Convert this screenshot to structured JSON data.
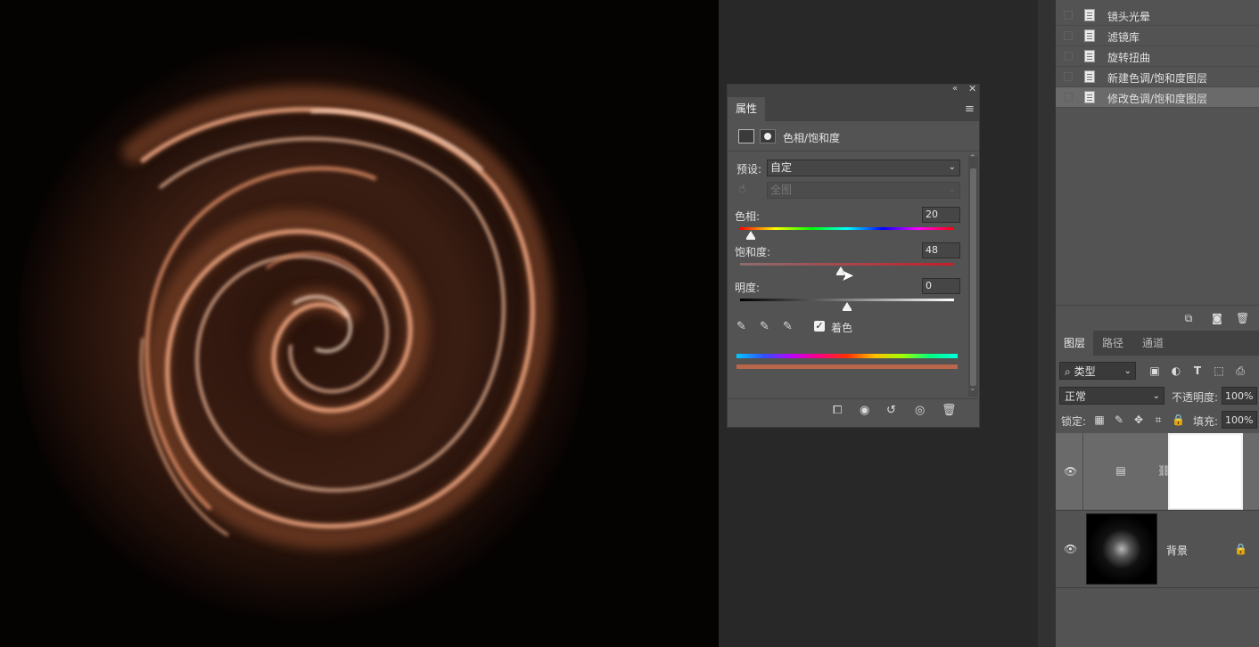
{
  "history": {
    "items": [
      {
        "label": "镜头光晕",
        "selected": false
      },
      {
        "label": "滤镜库",
        "selected": false
      },
      {
        "label": "旋转扭曲",
        "selected": false
      },
      {
        "label": "新建色调/饱和度图层",
        "selected": false
      },
      {
        "label": "修改色调/饱和度图层",
        "selected": true
      }
    ],
    "bottom_icons": [
      "new-document-icon",
      "camera-icon",
      "trash-icon"
    ]
  },
  "properties": {
    "tab_label": "属性",
    "adjustment_title": "色相/饱和度",
    "preset_label": "预设:",
    "preset_value": "自定",
    "channel_value": "全图",
    "hue": {
      "label": "色相:",
      "value": "20",
      "fraction": 0.05
    },
    "saturation": {
      "label": "饱和度:",
      "value": "48",
      "fraction": 0.47
    },
    "lightness": {
      "label": "明度:",
      "value": "0",
      "fraction": 0.5
    },
    "colorize_label": "着色",
    "colorize_checked": true,
    "colorize_color": "#b8674a"
  },
  "layers": {
    "tabs": [
      "图层",
      "路径",
      "通道"
    ],
    "filter_label": "类型",
    "blend_mode": "正常",
    "opacity_label": "不透明度:",
    "opacity_value": "100%",
    "lock_label": "锁定:",
    "fill_label": "填充:",
    "fill_value": "100%",
    "items": [
      {
        "name": "",
        "type": "adjustment",
        "selected": true
      },
      {
        "name": "背景",
        "type": "image",
        "locked": true
      }
    ]
  }
}
